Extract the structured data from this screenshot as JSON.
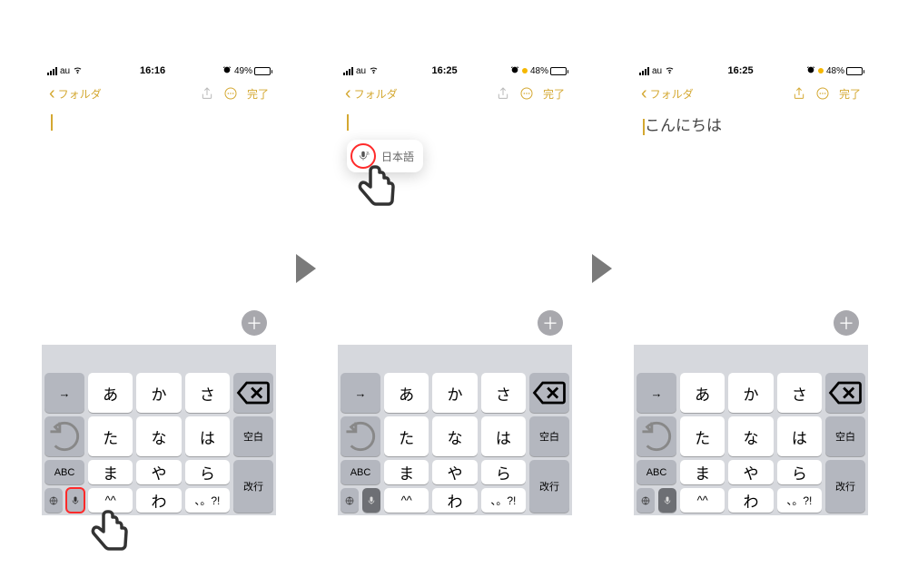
{
  "phones": [
    {
      "status": {
        "carrier": "au",
        "time": "16:16",
        "battery": "49%"
      },
      "nav": {
        "back": "フォルダ",
        "done": "完了"
      },
      "note": {
        "text": ""
      }
    },
    {
      "status": {
        "carrier": "au",
        "time": "16:25",
        "battery": "48%"
      },
      "nav": {
        "back": "フォルダ",
        "done": "完了"
      },
      "note": {
        "text": ""
      },
      "popup": {
        "label": "日本語"
      }
    },
    {
      "status": {
        "carrier": "au",
        "time": "16:25",
        "battery": "48%"
      },
      "nav": {
        "back": "フォルダ",
        "done": "完了"
      },
      "note": {
        "text": "こんにちは"
      }
    }
  ],
  "keyboard": {
    "rows": {
      "r1": {
        "side_l": "→",
        "k1": "あ",
        "k2": "か",
        "k3": "さ",
        "del": "⌫"
      },
      "r2": {
        "side_l": "↺",
        "k1": "た",
        "k2": "な",
        "k3": "は",
        "space": "空白"
      },
      "r3": {
        "side_l": "ABC",
        "k1": "ま",
        "k2": "や",
        "k3": "ら",
        "enter": "改行"
      },
      "r4": {
        "k1": "^^",
        "k2": "わ",
        "k3": "、。?!"
      }
    }
  }
}
